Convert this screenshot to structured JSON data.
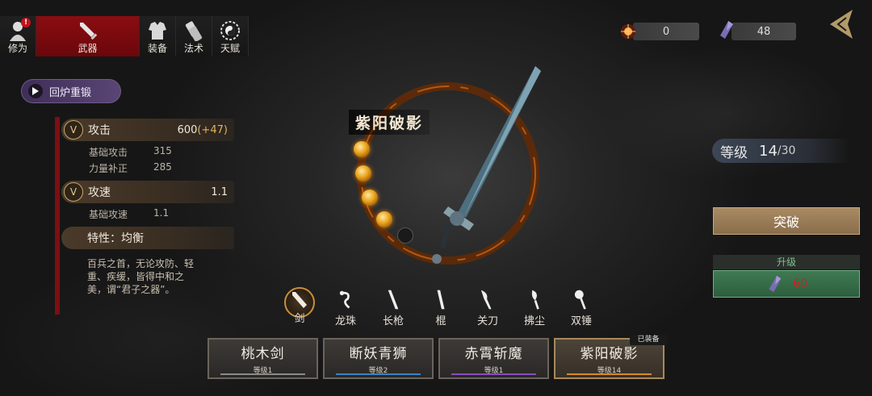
{
  "tabs": [
    {
      "label": "修为",
      "icon": "cultivation-icon",
      "badge": "!"
    },
    {
      "label": "武器",
      "icon": "sword-icon",
      "active": true
    },
    {
      "label": "装备",
      "icon": "armor-icon"
    },
    {
      "label": "法术",
      "icon": "scroll-icon"
    },
    {
      "label": "天赋",
      "icon": "taiji-icon"
    }
  ],
  "resources": [
    {
      "icon": "fire-orb-icon",
      "value": "0"
    },
    {
      "icon": "purple-crystal-icon",
      "value": "48"
    }
  ],
  "recast_label": "回炉重锻",
  "stats": {
    "attack": {
      "label": "攻击",
      "value": "600",
      "bonus": "(+47)"
    },
    "base_attack": {
      "label": "基础攻击",
      "value": "315"
    },
    "power_fix": {
      "label": "力量补正",
      "value": "285"
    },
    "speed": {
      "label": "攻速",
      "value": "1.1"
    },
    "base_speed": {
      "label": "基础攻速",
      "value": "1.1"
    },
    "trait": {
      "label": "特性：均衡"
    },
    "desc": "百兵之首，无论攻防、轻重、疾缓，皆得中和之美，谓“君子之器”。"
  },
  "weapon_name": "紫阳破影",
  "level": {
    "label": "等级",
    "current": "14",
    "max": "/30"
  },
  "breakthrough_label": "突破",
  "upgrade": {
    "label": "升级",
    "cost": "60"
  },
  "weapon_types": [
    {
      "label": "剑",
      "active": true
    },
    {
      "label": "龙珠"
    },
    {
      "label": "长枪"
    },
    {
      "label": "棍"
    },
    {
      "label": "关刀"
    },
    {
      "label": "拂尘"
    },
    {
      "label": "双锤"
    }
  ],
  "weapons": [
    {
      "name": "桃木剑",
      "level": "等级1",
      "color": "#8a8a8a"
    },
    {
      "name": "断妖青狮",
      "level": "等级2",
      "color": "#3b82c4"
    },
    {
      "name": "赤霄斩魔",
      "level": "等级1",
      "color": "#8a4ac4"
    },
    {
      "name": "紫阳破影",
      "level": "等级14",
      "color": "#d88a2a",
      "selected": true
    }
  ],
  "equipped_label": "已装备",
  "colors": {
    "active_tab": "#8a0d12",
    "upgrade_green": "#3f7a53",
    "breakthrough_gold": "#a88a64"
  }
}
